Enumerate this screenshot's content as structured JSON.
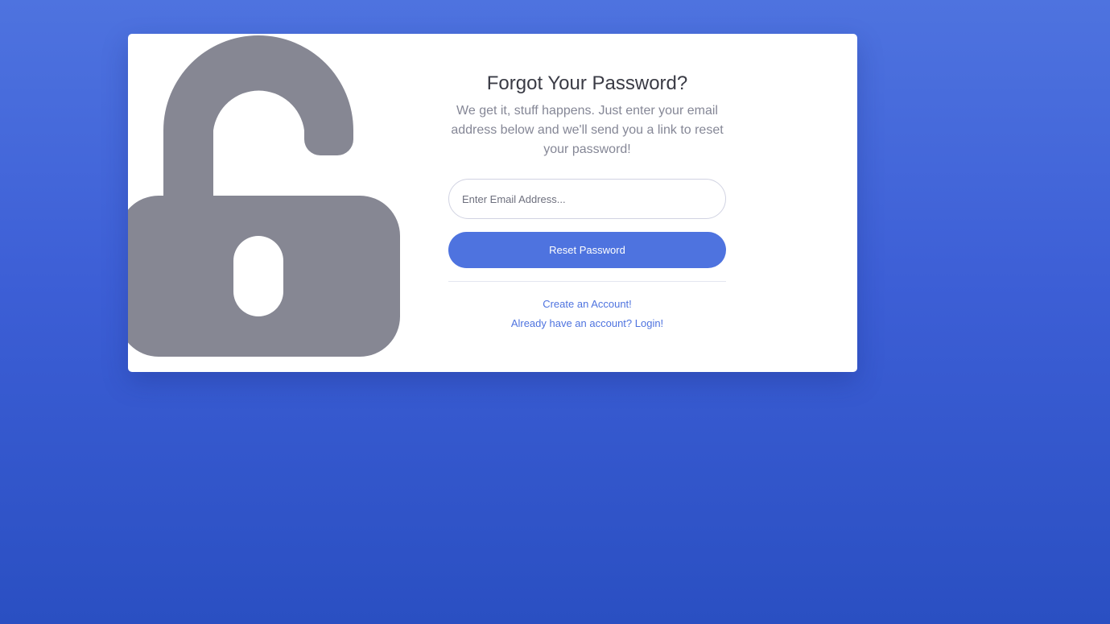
{
  "colors": {
    "primary": "#4e73df",
    "lock_icon": "#868793",
    "title_text": "#3a3b45",
    "muted_text": "#858796",
    "card_bg": "#ffffff"
  },
  "illustration": {
    "icon": "unlock-icon"
  },
  "form": {
    "title": "Forgot Your Password?",
    "subtitle": "We get it, stuff happens. Just enter your email address below and we'll send you a link to reset your password!",
    "email": {
      "placeholder": "Enter Email Address...",
      "value": ""
    },
    "submit_label": "Reset Password"
  },
  "links": {
    "create_account": "Create an Account!",
    "login": "Already have an account? Login!"
  }
}
